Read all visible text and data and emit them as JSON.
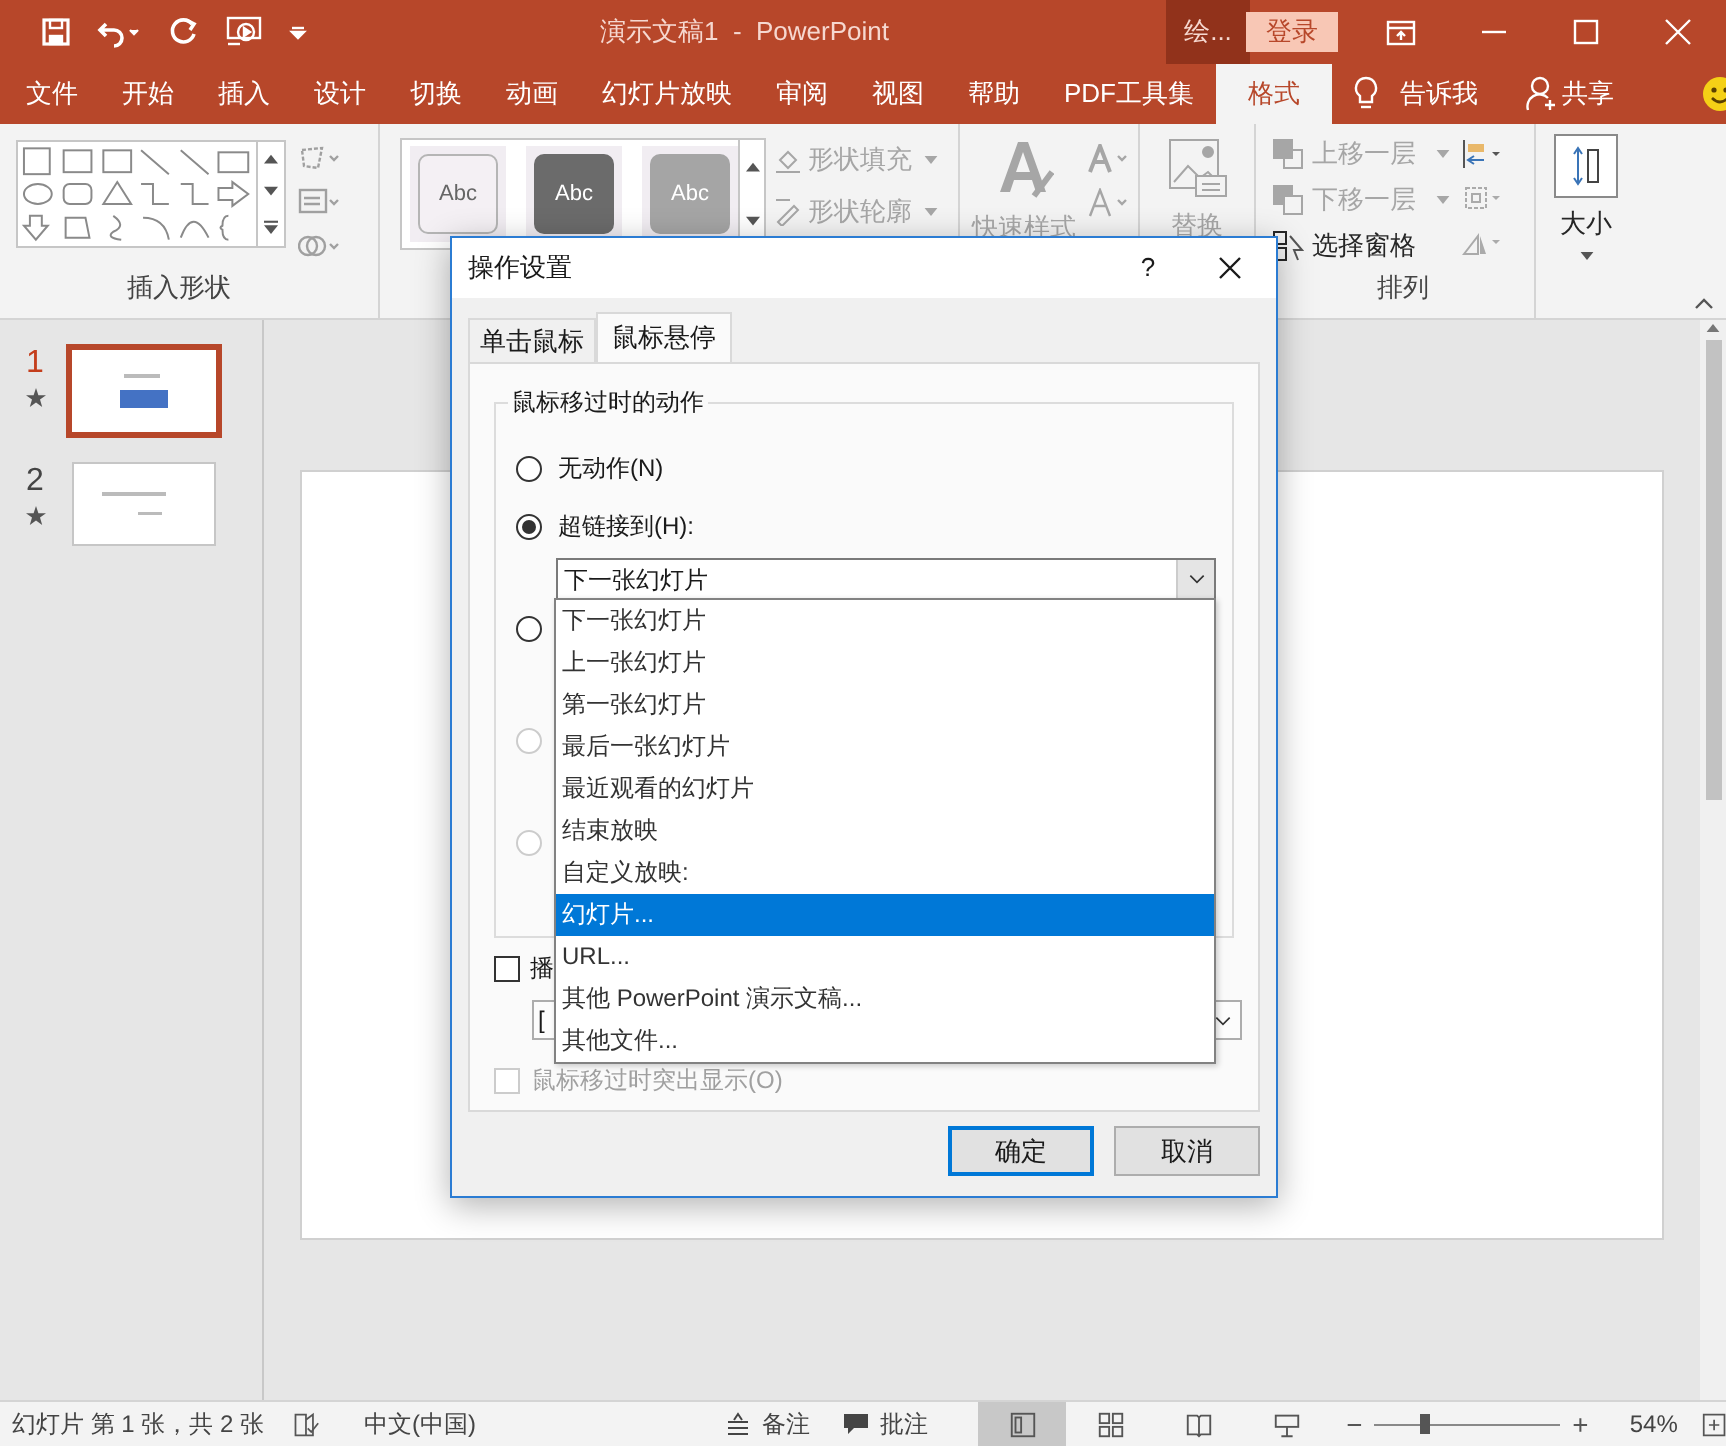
{
  "titlebar": {
    "title": "演示文稿1  -  PowerPoint",
    "context_tab": "绘...",
    "login": "登录"
  },
  "ribbon_tabs": [
    {
      "label": "文件",
      "selected": false
    },
    {
      "label": "开始",
      "selected": false
    },
    {
      "label": "插入",
      "selected": false
    },
    {
      "label": "设计",
      "selected": false
    },
    {
      "label": "切换",
      "selected": false
    },
    {
      "label": "动画",
      "selected": false
    },
    {
      "label": "幻灯片放映",
      "selected": false
    },
    {
      "label": "审阅",
      "selected": false
    },
    {
      "label": "视图",
      "selected": false
    },
    {
      "label": "帮助",
      "selected": false
    },
    {
      "label": "PDF工具集",
      "selected": false
    },
    {
      "label": "格式",
      "selected": true
    }
  ],
  "tell_me": "告诉我",
  "share": "共享",
  "ribbon": {
    "insert_shapes_label": "插入形状",
    "style_samples": [
      {
        "label": "Abc",
        "color": "#f4f0f4"
      },
      {
        "label": "Abc",
        "color": "#6b6b6b"
      },
      {
        "label": "Abc",
        "color": "#a5a5a5"
      }
    ],
    "shape_fill": {
      "label": "形状填充",
      "disabled": true
    },
    "shape_outline": {
      "label": "形状轮廓",
      "disabled": true
    },
    "quick_styles": {
      "label": "快速样式",
      "disabled": true
    },
    "replace": {
      "label": "替换",
      "disabled": true
    },
    "arrange": [
      {
        "label": "上移一层",
        "disabled": true
      },
      {
        "label": "下移一层",
        "disabled": true
      },
      {
        "label": "选择窗格",
        "disabled": false
      }
    ],
    "arrange_label": "排列",
    "size": "大小"
  },
  "slides": [
    {
      "number": "1",
      "selected": true
    },
    {
      "number": "2",
      "selected": false
    }
  ],
  "dialog": {
    "title": "操作设置",
    "help": "?",
    "tabs": [
      {
        "label": "单击鼠标",
        "selected": false
      },
      {
        "label": "鼠标悬停",
        "selected": true
      }
    ],
    "group_title": "鼠标移过时的动作",
    "options": [
      {
        "label": "无动作(N)",
        "selected": false,
        "disabled": false
      },
      {
        "label": "超链接到(H):",
        "selected": true,
        "disabled": false
      },
      {
        "selected": false,
        "disabled": false
      },
      {
        "selected": false,
        "disabled": true
      },
      {
        "selected": false,
        "disabled": true
      }
    ],
    "hyperlink_value": "下一张幻灯片",
    "dropdown_items": [
      {
        "label": "下一张幻灯片",
        "selected": false
      },
      {
        "label": "上一张幻灯片",
        "selected": false
      },
      {
        "label": "第一张幻灯片",
        "selected": false
      },
      {
        "label": "最后一张幻灯片",
        "selected": false
      },
      {
        "label": "最近观看的幻灯片",
        "selected": false
      },
      {
        "label": "结束放映",
        "selected": false
      },
      {
        "label": "自定义放映:",
        "selected": false
      },
      {
        "label": "幻灯片...",
        "selected": true
      },
      {
        "label": "URL...",
        "selected": false
      },
      {
        "label": "其他 PowerPoint 演示文稿...",
        "selected": false
      },
      {
        "label": "其他文件...",
        "selected": false
      }
    ],
    "play_sound": {
      "label": "播",
      "checked": false
    },
    "sound_value": "[",
    "highlight": {
      "label": "鼠标移过时突出显示(O)",
      "checked": false,
      "disabled": true
    },
    "buttons": [
      {
        "label": "确定",
        "default": true
      },
      {
        "label": "取消",
        "default": false
      }
    ]
  },
  "status_bar": {
    "slide_info": "幻灯片 第 1 张，共 2 张",
    "language": "中文(中国)",
    "notes": "备注",
    "comments": "批注",
    "views": [
      {
        "kind": "normal",
        "selected": true
      },
      {
        "kind": "sorter",
        "selected": false
      },
      {
        "kind": "reading",
        "selected": false
      },
      {
        "kind": "slideshow",
        "selected": false
      }
    ],
    "zoom_level": {
      "level": 0.26
    },
    "zoom": "54%"
  }
}
